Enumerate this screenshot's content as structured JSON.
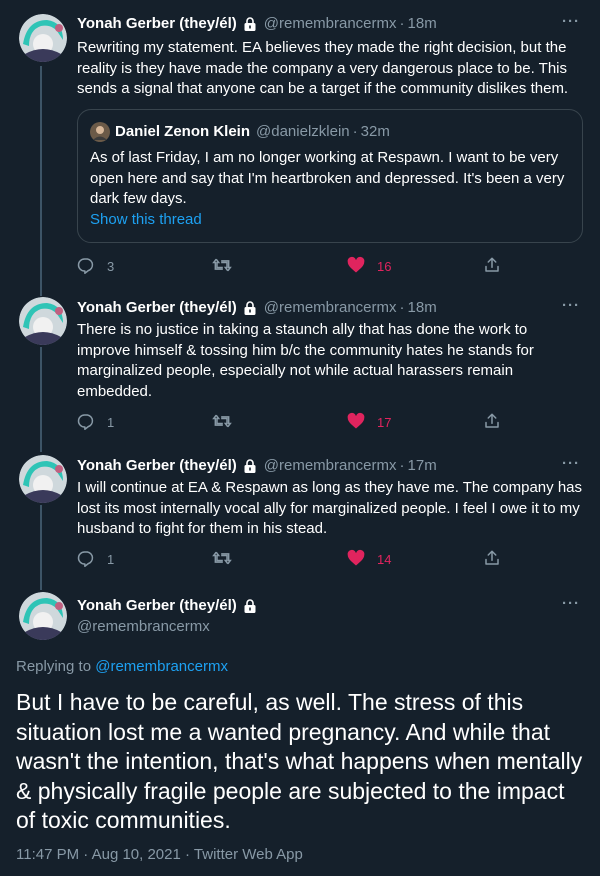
{
  "thread": [
    {
      "name": "Yonah Gerber (they/él)",
      "handle": "@remembrancermx",
      "dot": "·",
      "time": "18m",
      "text": "Rewriting my statement. EA believes they made the right decision, but the reality is they have made the company a very dangerous place to be. This sends a signal that anyone can be a target if the community dislikes them.",
      "quote": {
        "name": "Daniel Zenon Klein",
        "handle": "@danielzklein",
        "dot": "·",
        "time": "32m",
        "text": "As of last Friday, I am no longer working at Respawn. I want to be very open here and say that I'm heartbroken and depressed. It's been a very dark few days.",
        "link": "Show this thread"
      },
      "replies": "3",
      "retweets": "",
      "likes": "16"
    },
    {
      "name": "Yonah Gerber (they/él)",
      "handle": "@remembrancermx",
      "dot": "·",
      "time": "18m",
      "text": "There is no justice in taking a staunch ally that has done the work to improve himself & tossing him b/c the community hates he stands for marginalized people, especially not while actual harassers remain embedded.",
      "replies": "1",
      "retweets": "",
      "likes": "17"
    },
    {
      "name": "Yonah Gerber (they/él)",
      "handle": "@remembrancermx",
      "dot": "·",
      "time": "17m",
      "text": "I will continue at EA & Respawn as long as they have me. The company has lost its most internally vocal ally for marginalized people. I feel I owe it to my husband to fight for them in his stead.",
      "replies": "1",
      "retweets": "",
      "likes": "14"
    }
  ],
  "main": {
    "name": "Yonah Gerber (they/él)",
    "handle": "@remembrancermx",
    "replying_prefix": "Replying to ",
    "replying_to": "@remembrancermx",
    "text": "But I have to be careful, as well. The stress of this situation lost me a wanted pregnancy. And while that wasn't the intention, that's what happens when mentally & physically fragile people are subjected to the impact of toxic communities.",
    "meta": "11:47 PM · Aug 10, 2021 · Twitter Web App"
  },
  "more_label": "···",
  "icons": {
    "reply": "reply-icon",
    "retweet": "retweet-icon",
    "like": "heart-icon",
    "share": "share-icon",
    "lock": "lock-icon",
    "more": "more-icon"
  },
  "colors": {
    "background": "#15202b",
    "secondary_text": "#8899a6",
    "link": "#1da1f2",
    "like": "#e0245e",
    "border": "#38444d"
  }
}
